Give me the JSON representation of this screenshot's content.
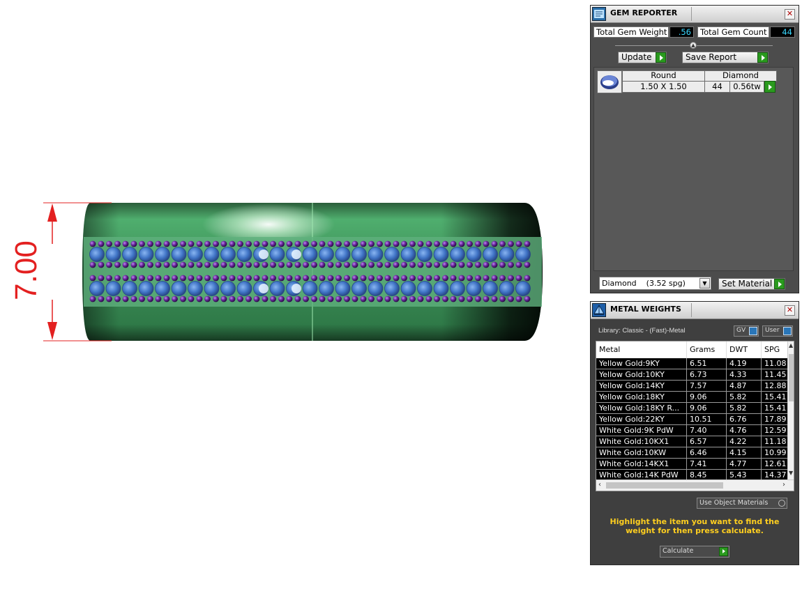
{
  "viewport": {
    "dimension_label": "7.00",
    "colors": {
      "metal": "#2f9a52",
      "gems": "#3d6fd0",
      "prongs": "#5a1a8c",
      "dimension": "#e32020"
    }
  },
  "gem_reporter": {
    "title": "GEM REPORTER",
    "total_weight_label": "Total Gem Weight",
    "total_weight_value": ".56",
    "total_count_label": "Total Gem Count",
    "total_count_value": "44",
    "update_label": "Update",
    "save_report_label": "Save Report",
    "gem_row": {
      "shape_header": "Round",
      "type_header": "Diamond",
      "size": "1.50 X 1.50",
      "count": "44",
      "weight": "0.56tw"
    },
    "material_select": "Diamond    (3.52 spg)",
    "set_material_label": "Set Material"
  },
  "metal_weights": {
    "title": "METAL WEIGHTS",
    "library_label": "Library: Classic - (Fast)-Metal",
    "gv_label": "GV",
    "user_label": "User",
    "columns": [
      "Metal",
      "Grams",
      "DWT",
      "SPG"
    ],
    "rows": [
      {
        "metal": "Yellow Gold:9KY",
        "grams": "6.51",
        "dwt": "4.19",
        "spg": "11.08"
      },
      {
        "metal": "Yellow Gold:10KY",
        "grams": "6.73",
        "dwt": "4.33",
        "spg": "11.45"
      },
      {
        "metal": "Yellow Gold:14KY",
        "grams": "7.57",
        "dwt": "4.87",
        "spg": "12.88"
      },
      {
        "metal": "Yellow Gold:18KY",
        "grams": "9.06",
        "dwt": "5.82",
        "spg": "15.41"
      },
      {
        "metal": "Yellow Gold:18KY R...",
        "grams": "9.06",
        "dwt": "5.82",
        "spg": "15.41"
      },
      {
        "metal": "Yellow Gold:22KY",
        "grams": "10.51",
        "dwt": "6.76",
        "spg": "17.89"
      },
      {
        "metal": "White Gold:9K PdW",
        "grams": "7.40",
        "dwt": "4.76",
        "spg": "12.59"
      },
      {
        "metal": "White Gold:10KX1",
        "grams": "6.57",
        "dwt": "4.22",
        "spg": "11.18"
      },
      {
        "metal": "White Gold:10KW",
        "grams": "6.46",
        "dwt": "4.15",
        "spg": "10.99"
      },
      {
        "metal": "White Gold:14KX1",
        "grams": "7.41",
        "dwt": "4.77",
        "spg": "12.61"
      },
      {
        "metal": "White Gold:14K PdW",
        "grams": "8.45",
        "dwt": "5.43",
        "spg": "14.37"
      }
    ],
    "use_object_materials_label": "Use Object Materials",
    "hint_text": "Highlight the item you want to find the weight for then press calculate.",
    "calculate_label": "Calculate"
  }
}
